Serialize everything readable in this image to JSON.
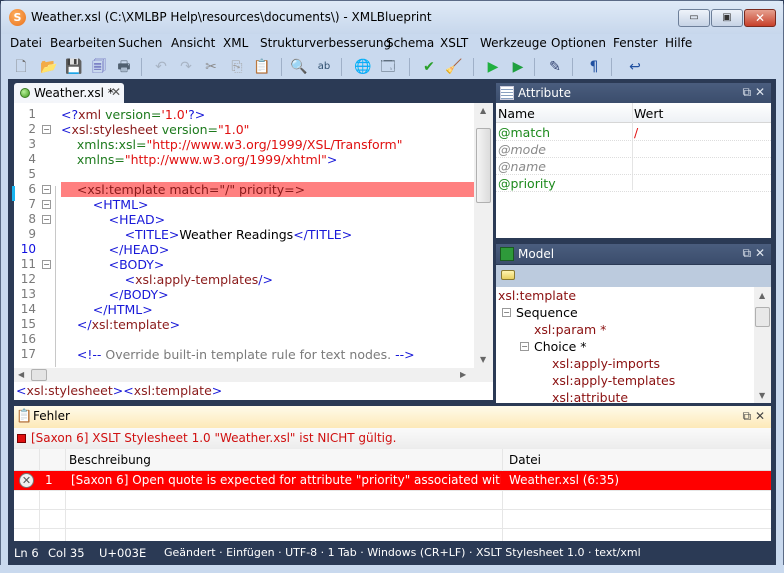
{
  "window": {
    "title": "Weather.xsl  (C:\\XMLBP Help\\resources\\documents\\) - XMLBlueprint",
    "app_icon": "xmlblueprint-logo-icon",
    "controls": {
      "minimize": "▭",
      "maximize": "▣",
      "close": "✕"
    }
  },
  "menu": [
    "Datei",
    "Bearbeiten",
    "Suchen",
    "Ansicht",
    "XML",
    "Strukturverbesserung",
    "Schema",
    "XSLT",
    "Werkzeuge",
    "Optionen",
    "Fenster",
    "Hilfe"
  ],
  "toolbar": {
    "buttons": [
      {
        "name": "new-document-icon",
        "glyph": "🗋"
      },
      {
        "name": "open-folder-icon",
        "glyph": "📂"
      },
      {
        "name": "save-icon",
        "glyph": "💾"
      },
      {
        "name": "save-all-icon",
        "glyph": "🗐"
      },
      {
        "name": "print-icon",
        "glyph": "🖶"
      },
      {
        "name": "undo-icon",
        "glyph": "↶"
      },
      {
        "name": "redo-icon",
        "glyph": "↷"
      },
      {
        "name": "cut-icon",
        "glyph": "✂"
      },
      {
        "name": "copy-icon",
        "glyph": "⎘"
      },
      {
        "name": "paste-icon",
        "glyph": "📋"
      },
      {
        "name": "find-icon",
        "glyph": "🔍"
      },
      {
        "name": "replace-icon",
        "glyph": "ab"
      },
      {
        "name": "browser-preview-icon",
        "glyph": "🌐"
      },
      {
        "name": "print-preview-icon",
        "glyph": "🗔"
      },
      {
        "name": "validate-check-icon",
        "glyph": "✔"
      },
      {
        "name": "clean-broom-icon",
        "glyph": "🧹"
      },
      {
        "name": "run-transform-icon",
        "glyph": "▶"
      },
      {
        "name": "run-settings-icon",
        "glyph": "▶"
      },
      {
        "name": "xml-tool-icon",
        "glyph": "✎"
      },
      {
        "name": "pilcrow-icon",
        "glyph": "¶"
      },
      {
        "name": "word-wrap-icon",
        "glyph": "↩"
      }
    ]
  },
  "editor": {
    "tab_label": "Weather.xsl *",
    "tab_close": "✕",
    "line_numbers": [
      "1",
      "2",
      "3",
      "4",
      "5",
      "6",
      "7",
      "8",
      "9",
      "10",
      "11",
      "12",
      "13",
      "14",
      "15",
      "16",
      "17"
    ],
    "current_line": "10",
    "lines": [
      [
        {
          "c": "t",
          "s": "<?"
        },
        {
          "c": "en",
          "s": "xml"
        },
        {
          "c": "an",
          "s": " version="
        },
        {
          "c": "av",
          "s": "'1.0'"
        },
        {
          "c": "t",
          "s": "?>"
        }
      ],
      [
        {
          "c": "t",
          "s": "<"
        },
        {
          "c": "en",
          "s": "xsl:stylesheet"
        },
        {
          "c": "an",
          "s": " version="
        },
        {
          "c": "av",
          "s": "\"1.0\""
        }
      ],
      [
        {
          "c": "an",
          "s": "    xmlns:xsl="
        },
        {
          "c": "av",
          "s": "\"http://www.w3.org/1999/XSL/Transform\""
        }
      ],
      [
        {
          "c": "an",
          "s": "    xmlns="
        },
        {
          "c": "av",
          "s": "\"http://www.w3.org/1999/xhtml\""
        },
        {
          "c": "t",
          "s": ">"
        }
      ],
      [],
      [
        {
          "c": "tx",
          "s": "    <xsl:template match=\"/\" priority=>"
        }
      ],
      [
        {
          "c": "t",
          "s": "        <HTML>"
        }
      ],
      [
        {
          "c": "t",
          "s": "            <HEAD>"
        }
      ],
      [
        {
          "c": "t",
          "s": "                <TITLE>"
        },
        {
          "c": "tx",
          "s": "Weather Readings"
        },
        {
          "c": "t",
          "s": "</TITLE>"
        }
      ],
      [
        {
          "c": "t",
          "s": "            </HEAD>"
        }
      ],
      [
        {
          "c": "t",
          "s": "            <BODY>"
        }
      ],
      [
        {
          "c": "t",
          "s": "                <"
        },
        {
          "c": "en",
          "s": "xsl:apply-templates"
        },
        {
          "c": "t",
          "s": "/>"
        }
      ],
      [
        {
          "c": "t",
          "s": "            </BODY>"
        }
      ],
      [
        {
          "c": "t",
          "s": "        </HTML>"
        }
      ],
      [
        {
          "c": "t",
          "s": "    </"
        },
        {
          "c": "en",
          "s": "xsl:template"
        },
        {
          "c": "t",
          "s": ">"
        }
      ],
      [],
      [
        {
          "c": "t",
          "s": "    <!--"
        },
        {
          "c": "cm",
          "s": " Override built-in template rule for text nodes. "
        },
        {
          "c": "t",
          "s": "-->"
        }
      ]
    ],
    "breadcrumb": [
      {
        "c": "t",
        "s": "<"
      },
      {
        "c": "en",
        "s": "xsl:stylesheet"
      },
      {
        "c": "t",
        "s": "><"
      },
      {
        "c": "en",
        "s": "xsl:template"
      },
      {
        "c": "t",
        "s": ">"
      }
    ]
  },
  "attribute_panel": {
    "title": "Attribute",
    "columns": [
      "Name",
      "Wert"
    ],
    "rows": [
      {
        "name": "@match",
        "value": "/",
        "used": true
      },
      {
        "name": "@mode",
        "value": "",
        "used": false
      },
      {
        "name": "@name",
        "value": "",
        "used": false
      },
      {
        "name": "@priority",
        "value": "",
        "used": true
      }
    ]
  },
  "model_panel": {
    "title": "Model",
    "tree": [
      {
        "label": "xsl:template",
        "kind": "element"
      },
      {
        "label": "Sequence",
        "kind": "group"
      },
      {
        "label": "xsl:param *",
        "kind": "element"
      },
      {
        "label": "Choice *",
        "kind": "group"
      },
      {
        "label": "xsl:apply-imports",
        "kind": "element"
      },
      {
        "label": "xsl:apply-templates",
        "kind": "element"
      },
      {
        "label": "xsl:attribute",
        "kind": "element"
      }
    ]
  },
  "error_panel": {
    "title": "Fehler",
    "status": "[Saxon 6] XSLT Stylesheet 1.0 \"Weather.xsl\" ist NICHT gültig.",
    "columns": [
      "",
      "",
      "Beschreibung",
      "Datei"
    ],
    "rows": [
      {
        "num": "1",
        "description": "[Saxon 6] Open quote is expected for attribute \"priority\" associated with an elemer",
        "file": "Weather.xsl (6:35)"
      }
    ]
  },
  "statusbar": {
    "line": "Ln 6",
    "col": "Col 35",
    "char": "U+003E",
    "items": "Geändert · Einfügen · UTF-8 · 1 Tab · Windows (CR+LF) · XSLT Stylesheet 1.0 · text/xml"
  },
  "colors": {
    "error_row": "#ff0000",
    "error_line": "#ff8080",
    "tag": "#1818d8",
    "element": "#8a1a1a",
    "attr": "#1d7a1d",
    "value": "#e01010"
  }
}
